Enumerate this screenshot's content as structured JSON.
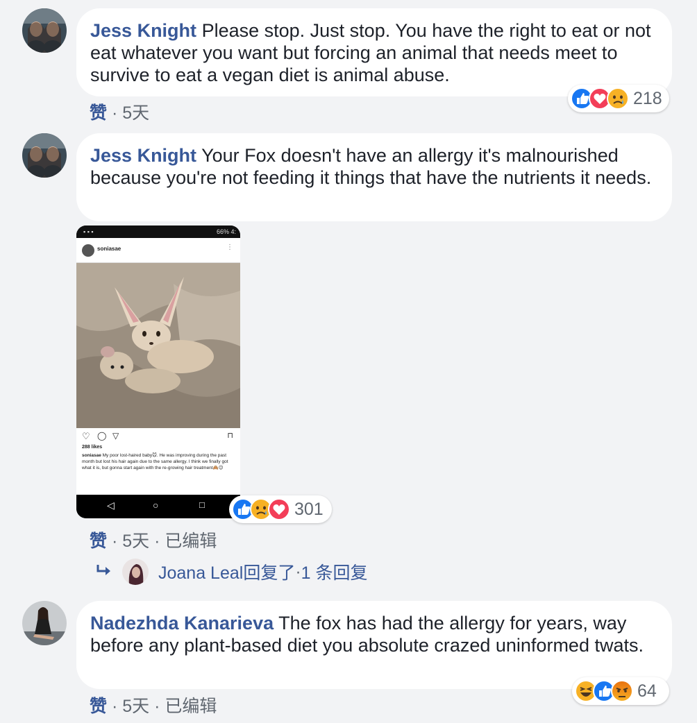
{
  "comments": [
    {
      "author": "Jess Knight",
      "text": "Please stop. Just stop. You have the right to eat or not eat whatever you want but forcing an animal that needs meet to survive to eat a vegan diet is animal abuse.",
      "meta": {
        "like": "赞",
        "sep": " · ",
        "time": "5天",
        "edited": ""
      },
      "reactions": {
        "icons": [
          "like-icon",
          "love-icon",
          "sad-icon"
        ],
        "count": "218"
      }
    },
    {
      "author": "Jess Knight",
      "text": "Your Fox doesn't have an allergy it's malnourished because you're not feeding it things that have the nutrients it needs.",
      "meta": {
        "like": "赞",
        "sep": " · ",
        "time": "5天",
        "sep2": " · ",
        "edited": "已编辑"
      },
      "reactions": {
        "icons": [
          "like-icon",
          "sad-icon",
          "love-icon"
        ],
        "count": "301"
      },
      "attachment": {
        "status_bar": "66% 4:",
        "username": "soniasae",
        "likes": "288 likes",
        "caption_user": "soniasae",
        "caption": "My poor lost-haired baby🐭. He was improving during the past month but lost his hair again due to the same allergy. I think we finally got what it is, but gonna start again with the re-growing hair treatment🙈😉"
      },
      "replies": {
        "label": "Joana Leal回复了",
        "sep": " · ",
        "count": "1 条回复"
      }
    },
    {
      "author": "Nadezhda Kanarieva",
      "text": "The fox has had the allergy for years, way before any plant-based diet you absolute crazed uninformed twats.",
      "meta": {
        "like": "赞",
        "sep": " · ",
        "time": "5天",
        "sep2": " · ",
        "edited": "已编辑"
      },
      "reactions": {
        "icons": [
          "haha-icon",
          "like-icon",
          "angry-icon"
        ],
        "count": "64"
      }
    }
  ],
  "colors": {
    "background": "#f2f3f5",
    "bubble": "#ffffff",
    "link": "#385898",
    "meta": "#606770",
    "like": "#1877f2",
    "love": "#f33e58",
    "yellow": "#f7b125",
    "angry": "#e9710f"
  }
}
